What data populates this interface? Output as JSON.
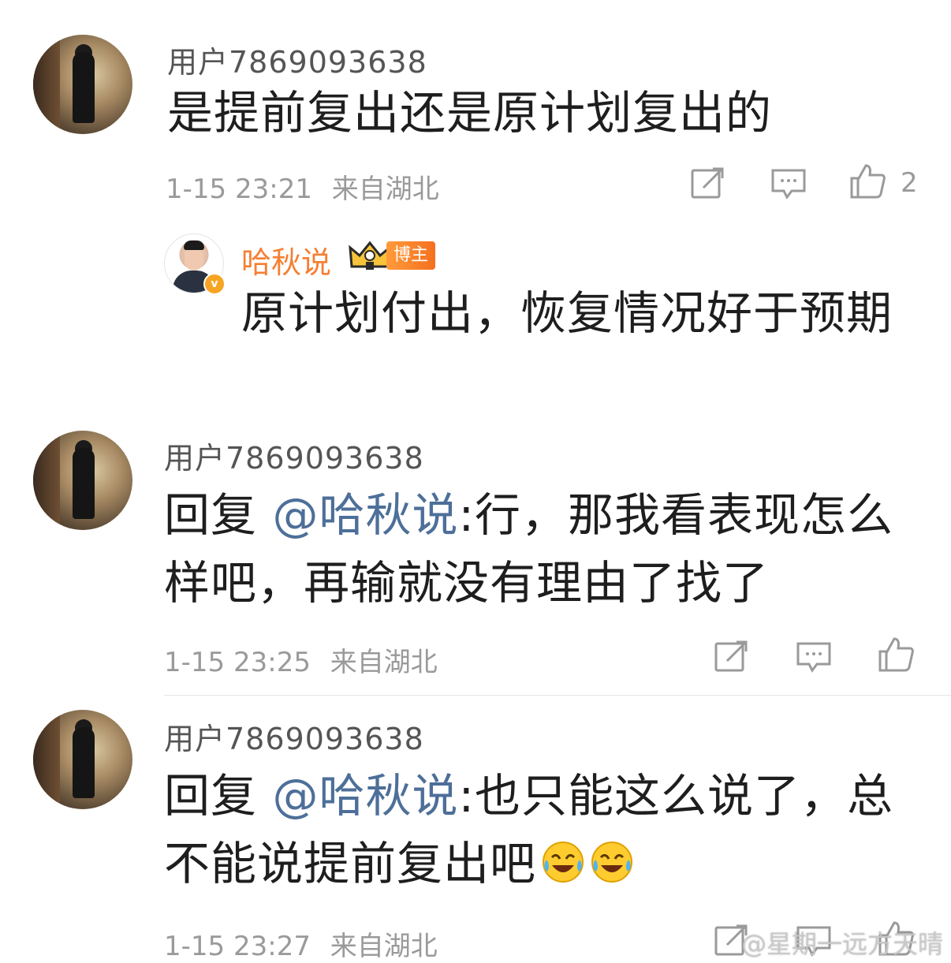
{
  "comments": [
    {
      "username": "用户7869093638",
      "text": "是提前复出还是原计划复出的",
      "time": "1-15 23:21",
      "location": "来自湖北",
      "like_count": "2"
    },
    {
      "username": "用户7869093638",
      "reply_prefix": "回复 ",
      "mention": "@哈秋说",
      "text": ":行，那我看表现怎么样吧，再输就没有理由了找了",
      "time": "1-15 23:25",
      "location": "来自湖北"
    },
    {
      "username": "用户7869093638",
      "reply_prefix": "回复 ",
      "mention": "@哈秋说",
      "text": ":也只能这么说了，总不能说提前复出吧",
      "time": "1-15 23:27",
      "location": "来自湖北"
    }
  ],
  "blogger_reply": {
    "name": "哈秋说",
    "badge": "博主",
    "text": "原计划付出，恢复情况好于预期"
  },
  "icons": {
    "share": "share-icon",
    "comment": "comment-icon",
    "like": "thumbs-up-icon",
    "emoji": "laughing-crying-emoji",
    "verified": "verified-v-icon",
    "crown": "crown-icon"
  },
  "watermark": "@星期一远方天晴",
  "colors": {
    "mention": "#4d6f99",
    "blogger_name": "#f57f32",
    "badge": "#f5701f",
    "meta": "#9a9a9a"
  }
}
